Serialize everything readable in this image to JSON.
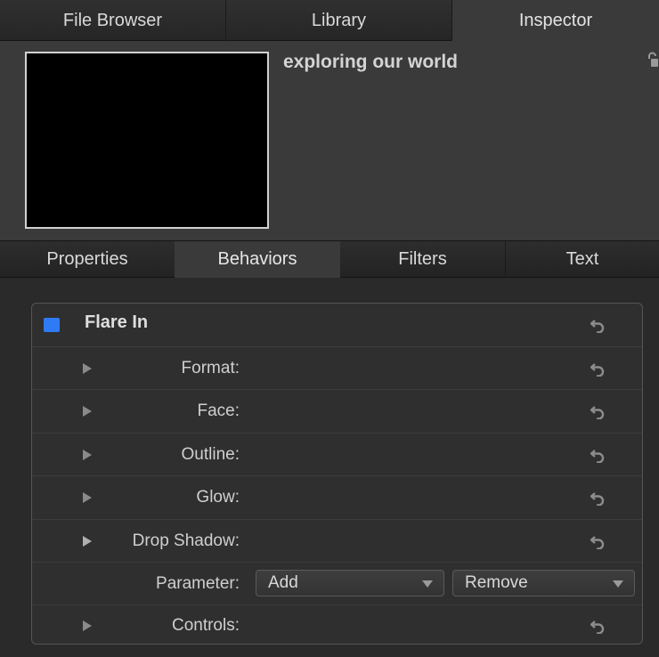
{
  "top_tabs": {
    "file_browser": "File Browser",
    "library": "Library",
    "inspector": "Inspector"
  },
  "preview": {
    "title": "exploring our world"
  },
  "sub_tabs": {
    "properties": "Properties",
    "behaviors": "Behaviors",
    "filters": "Filters",
    "text": "Text"
  },
  "behavior": {
    "name": "Flare In",
    "enabled": true,
    "rows": {
      "format": "Format:",
      "face": "Face:",
      "outline": "Outline:",
      "glow": "Glow:",
      "drop_shadow": "Drop Shadow:",
      "parameter": "Parameter:",
      "controls": "Controls:"
    },
    "parameter_add": "Add",
    "parameter_remove": "Remove"
  },
  "colors": {
    "accent": "#2f7bf6",
    "panel_bg": "#2f2f2f",
    "header_bg": "#3a3a3a"
  },
  "icons": {
    "lock": "lock-icon",
    "reset": "reset-arrow-icon",
    "disclosure": "disclosure-triangle-icon"
  }
}
